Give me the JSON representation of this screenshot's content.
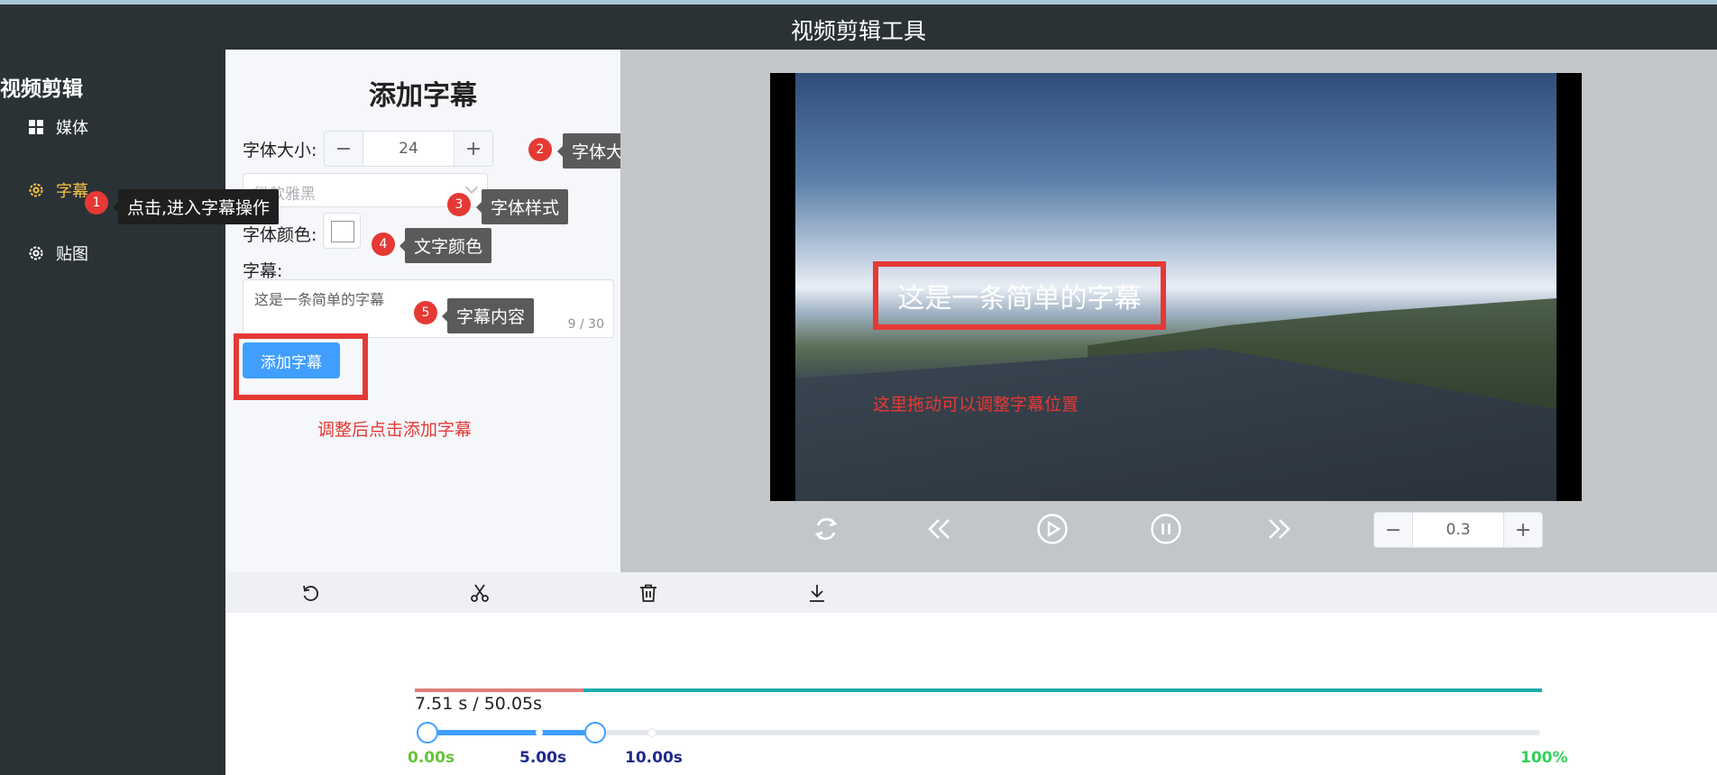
{
  "app": {
    "title": "视频剪辑工具"
  },
  "sidebar": {
    "brand": "视频剪辑",
    "items": [
      {
        "label": "媒体",
        "icon": "grid-icon"
      },
      {
        "label": "字幕",
        "icon": "gear-icon",
        "active": true
      },
      {
        "label": "贴图",
        "icon": "gear-icon"
      }
    ]
  },
  "panel": {
    "heading": "添加字幕",
    "font_size_label": "字体大小:",
    "font_size_value": "24",
    "font_family_placeholder": "微软雅黑",
    "font_color_label": "字体颜色:",
    "subtitle_label": "字幕:",
    "subtitle_text": "这是一条简单的字幕",
    "subtitle_count": "9 / 30",
    "add_button": "添加字幕",
    "hint": "调整后点击添加字幕"
  },
  "callouts": [
    {
      "num": "1",
      "text": "点击,进入字幕操作"
    },
    {
      "num": "2",
      "text": "字体大小"
    },
    {
      "num": "3",
      "text": "字体样式"
    },
    {
      "num": "4",
      "text": "文字颜色"
    },
    {
      "num": "5",
      "text": "字幕内容"
    }
  ],
  "preview": {
    "subtitle": "这是一条简单的字幕",
    "drag_hint": "这里拖动可以调整字幕位置",
    "speed_value": "0.3"
  },
  "timeline": {
    "time_text": "7.51 s / 50.05s",
    "marks": [
      "0.00s",
      "5.00s",
      "10.00s",
      "100%"
    ],
    "progress_fraction": 0.15
  },
  "colors": {
    "accent": "#409eff",
    "active": "#f6c344",
    "annotation": "#e53935",
    "teal": "#1aadad"
  }
}
